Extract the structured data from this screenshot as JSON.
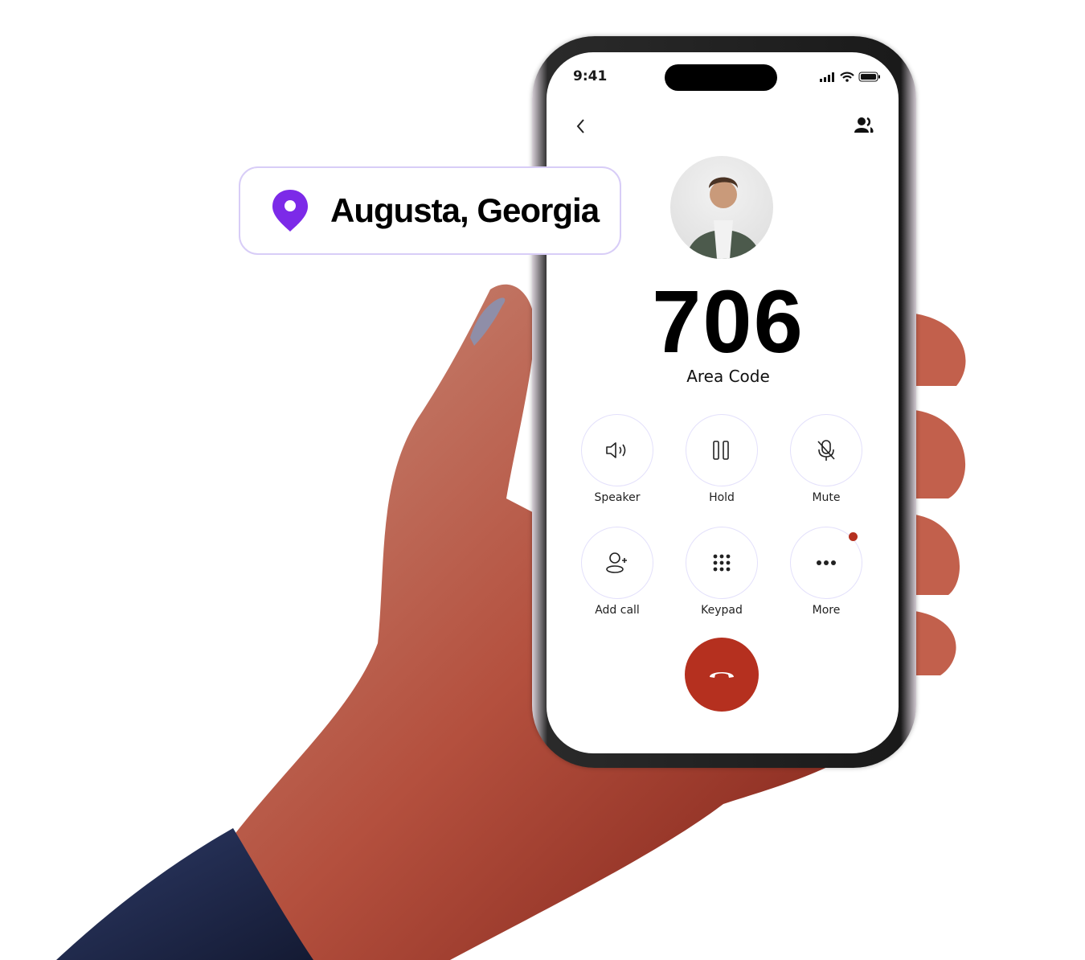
{
  "status_bar": {
    "time": "9:41",
    "icons": [
      "signal-icon",
      "wifi-icon",
      "battery-icon"
    ]
  },
  "header": {
    "back_icon": "chevron-left-icon",
    "contacts_icon": "contacts-icon"
  },
  "location_card": {
    "icon": "map-pin-icon",
    "text": "Augusta, Georgia",
    "accent": "#7c2ae8"
  },
  "call": {
    "area_code": "706",
    "area_code_label": "Area Code"
  },
  "controls": [
    {
      "label": "Speaker",
      "icon": "speaker-icon"
    },
    {
      "label": "Hold",
      "icon": "pause-icon"
    },
    {
      "label": "Mute",
      "icon": "mic-off-icon"
    },
    {
      "label": "Add call",
      "icon": "add-person-icon"
    },
    {
      "label": "Keypad",
      "icon": "keypad-icon"
    },
    {
      "label": "More",
      "icon": "more-icon",
      "badge": true
    }
  ],
  "end_call": {
    "icon": "end-call-icon",
    "color": "#b5301f"
  }
}
